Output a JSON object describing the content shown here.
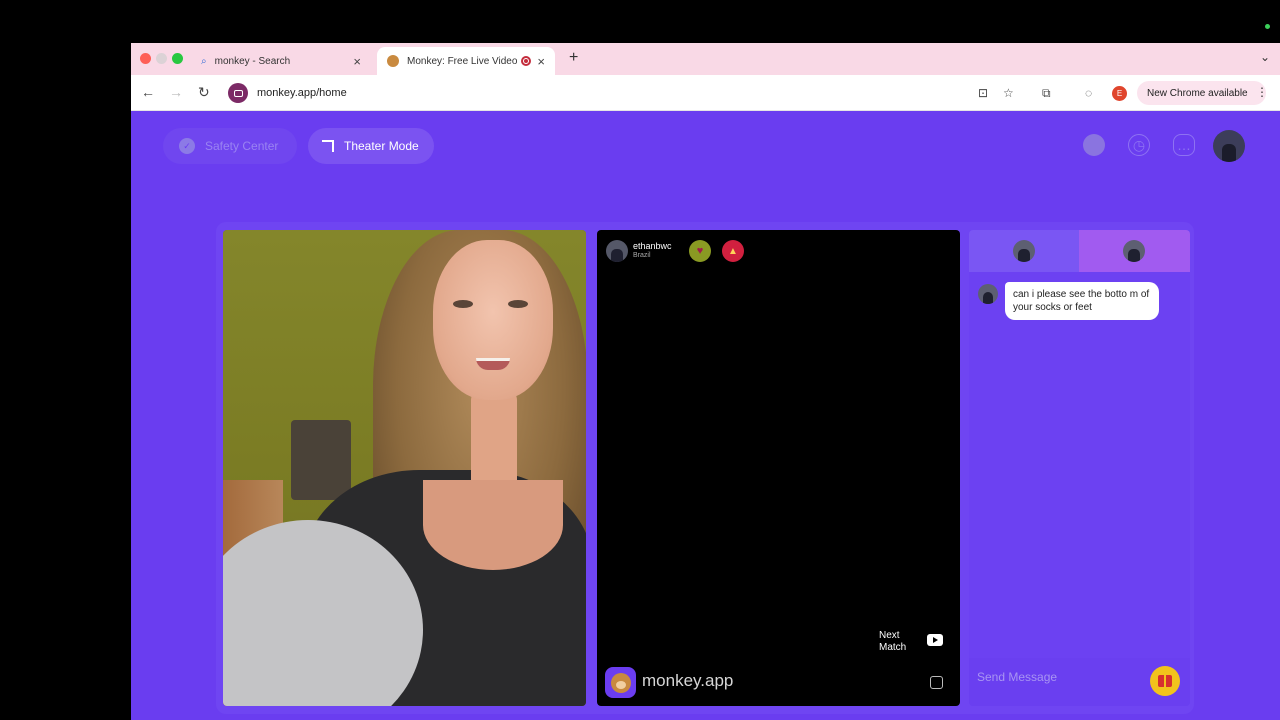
{
  "browser": {
    "tabs": [
      {
        "title": "monkey - Search",
        "close": "×"
      },
      {
        "title": "Monkey: Free Live Video C",
        "close": "×"
      }
    ],
    "new_tab": "+",
    "tab_menu": "⌄",
    "url": "monkey.app/home",
    "profile_initial": "E",
    "new_chrome": "New Chrome available",
    "nav": {
      "back": "←",
      "forward": "→",
      "reload": "↻"
    },
    "icons": {
      "install": "⊡",
      "star": "☆",
      "extensions": "⧉",
      "gauge": "◌",
      "kebab": "⋮"
    }
  },
  "page": {
    "safety_center": "Safety Center",
    "theater_mode": "Theater Mode"
  },
  "peer": {
    "username": "ethanbwc",
    "location": "Brazil"
  },
  "video": {
    "next_match": "Next Match",
    "brand": "monkey.app"
  },
  "chat": {
    "messages": [
      {
        "text": "can i please see the botto m of your socks or feet"
      }
    ],
    "placeholder": "Send Message"
  },
  "colors": {
    "page_bg": "#6a3df0",
    "tabstrip_bg": "#f9d9e6",
    "gift": "#f2c31c"
  }
}
